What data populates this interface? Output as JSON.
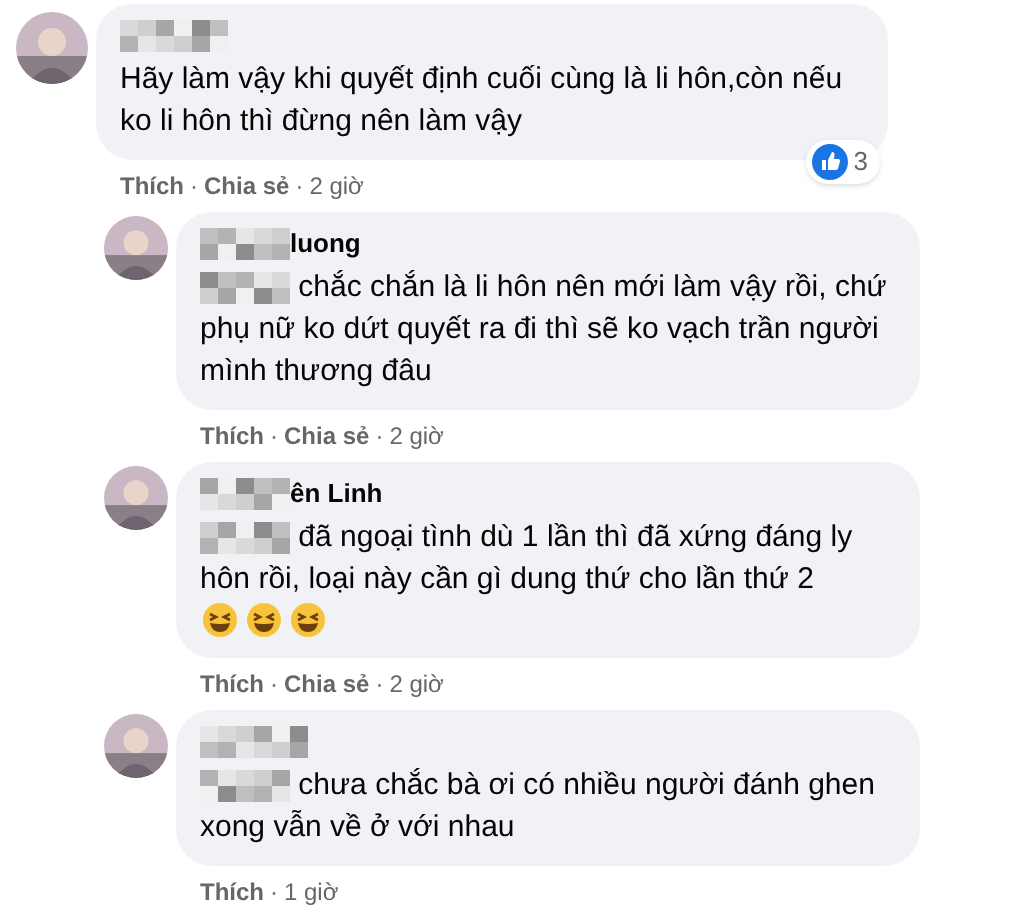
{
  "comments": [
    {
      "mention_redacted": false,
      "body": "Hãy làm vậy khi quyết định cuối cùng là li hôn,còn nếu ko li hôn thì đừng nên làm vậy",
      "actions": [
        "Thích",
        "Chia sẻ"
      ],
      "separators": [
        "·",
        "·"
      ],
      "time": "2 giờ",
      "reactions": {
        "kind": "like",
        "count": "3"
      },
      "reply": false
    },
    {
      "author_visible": "luong",
      "mention_redacted": true,
      "body": "chắc chắn là li hôn nên mới làm vậy rồi, chứ phụ nữ ko dứt quyết ra đi thì sẽ ko vạch trần người mình thương đâu",
      "actions": [
        "Thích",
        "Chia sẻ"
      ],
      "separators": [
        "·",
        "·"
      ],
      "time": "2 giờ",
      "reply": true
    },
    {
      "author_visible": "ên Linh",
      "mention_redacted": true,
      "body": "đã ngoại tình dù 1 lần thì đã xứng đáng ly hôn rồi, loại này cần gì dung thứ cho lần thứ 2",
      "emojis": [
        {
          "kind": "laughing"
        },
        {
          "kind": "laughing"
        },
        {
          "kind": "laughing"
        }
      ],
      "actions": [
        "Thích",
        "Chia sẻ"
      ],
      "separators": [
        "·",
        "·"
      ],
      "time": "2 giờ",
      "reply": true
    },
    {
      "mention_redacted": true,
      "body": "chưa chắc bà ơi có nhiều người đánh ghen xong vẫn về ở với nhau",
      "actions": [
        "Thích"
      ],
      "separators": [
        "·"
      ],
      "time": "1 giờ",
      "reply": true
    }
  ]
}
